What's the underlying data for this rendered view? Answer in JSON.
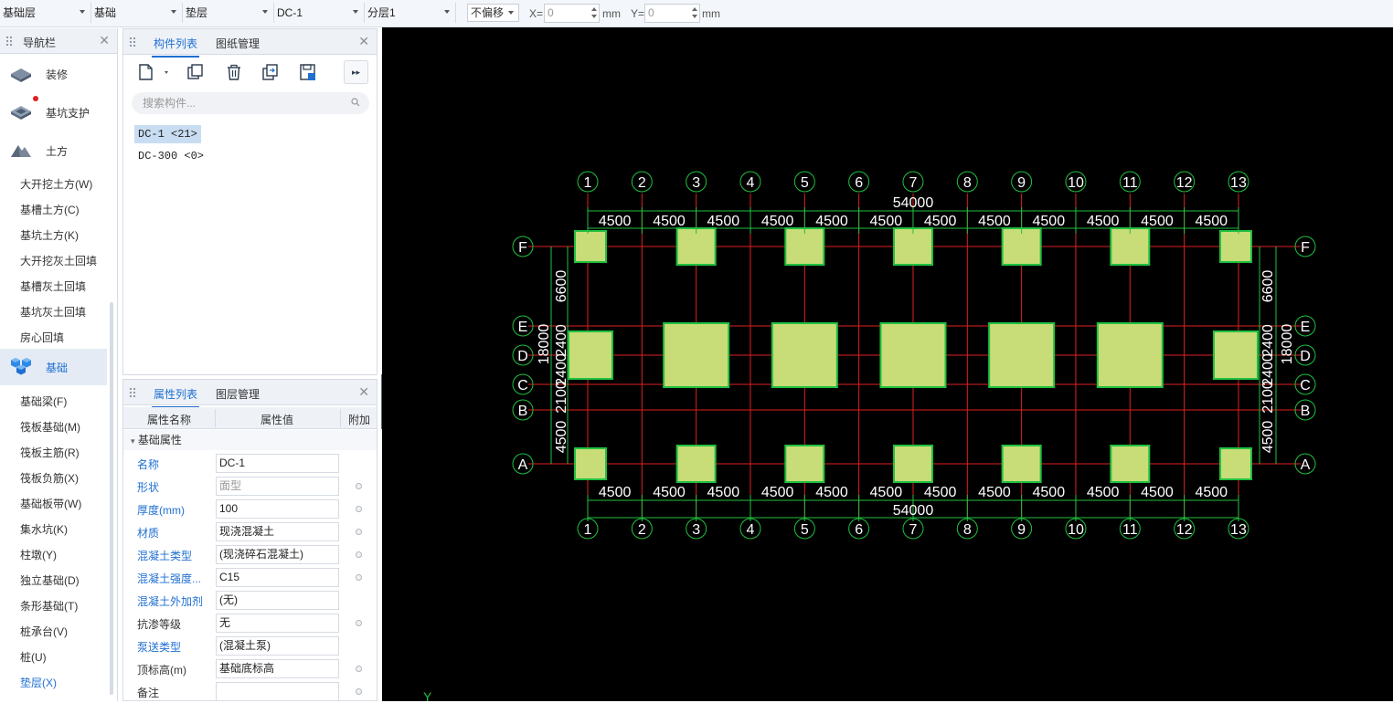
{
  "toolbar": {
    "dropdowns": [
      "基础层",
      "基础",
      "垫层",
      "DC-1",
      "分层1"
    ],
    "offset": "不偏移",
    "x_label": "X=",
    "x_value": "0",
    "y_label": "Y=",
    "y_value": "0",
    "unit": "mm"
  },
  "nav": {
    "title": "导航栏",
    "categories": [
      {
        "label": "装修",
        "icon": "decoration-icon"
      },
      {
        "label": "基坑支护",
        "icon": "pit-support-icon"
      },
      {
        "label": "土方",
        "icon": "earthwork-icon"
      }
    ],
    "earth_items": [
      "大开挖土方(W)",
      "基槽土方(C)",
      "基坑土方(K)",
      "大开挖灰土回填",
      "基槽灰土回填",
      "基坑灰土回填",
      "房心回填"
    ],
    "foundation": "基础",
    "foundation_items": [
      "基础梁(F)",
      "筏板基础(M)",
      "筏板主筋(R)",
      "筏板负筋(X)",
      "基础板带(W)",
      "集水坑(K)",
      "柱墩(Y)",
      "独立基础(D)",
      "条形基础(T)",
      "桩承台(V)",
      "桩(U)",
      "垫层(X)"
    ]
  },
  "component_panel": {
    "tabs": [
      "构件列表",
      "图纸管理"
    ],
    "search_placeholder": "搜索构件...",
    "items": [
      "DC-1 <21>",
      "DC-300 <0>"
    ]
  },
  "property_panel": {
    "tabs": [
      "属性列表",
      "图层管理"
    ],
    "headers": [
      "属性名称",
      "属性值",
      "附加"
    ],
    "group": "基础属性",
    "rows": [
      {
        "name": "名称",
        "value": "DC-1"
      },
      {
        "name": "形状",
        "value": "面型"
      },
      {
        "name": "厚度(mm)",
        "value": "100"
      },
      {
        "name": "材质",
        "value": "现浇混凝土"
      },
      {
        "name": "混凝土类型",
        "value": "(现浇碎石混凝土)"
      },
      {
        "name": "混凝土强度...",
        "value": "C15"
      },
      {
        "name": "混凝土外加剂",
        "value": "(无)"
      },
      {
        "name": "抗渗等级",
        "value": "无"
      },
      {
        "name": "泵送类型",
        "value": "(混凝土泵)"
      },
      {
        "name": "顶标高(m)",
        "value": "基础底标高"
      },
      {
        "name": "备注",
        "value": ""
      }
    ]
  },
  "drawing": {
    "axis_numbers": [
      "1",
      "2",
      "3",
      "4",
      "5",
      "6",
      "7",
      "8",
      "9",
      "10",
      "11",
      "12",
      "13"
    ],
    "axis_letters": [
      "A",
      "B",
      "C",
      "D",
      "E",
      "F"
    ],
    "spacing_label": "4500",
    "total_length": "54000",
    "total_width": "18000",
    "side_dims": [
      "6600",
      "2400",
      "2400",
      "2100",
      "4500"
    ],
    "axis_y": "Y",
    "colors": {
      "background": "#000000",
      "axis": "#e02020",
      "pad_fill": "#c8dc78",
      "pad_edge": "#20c040",
      "dim": "#20c040",
      "text": "#ffffff"
    }
  }
}
